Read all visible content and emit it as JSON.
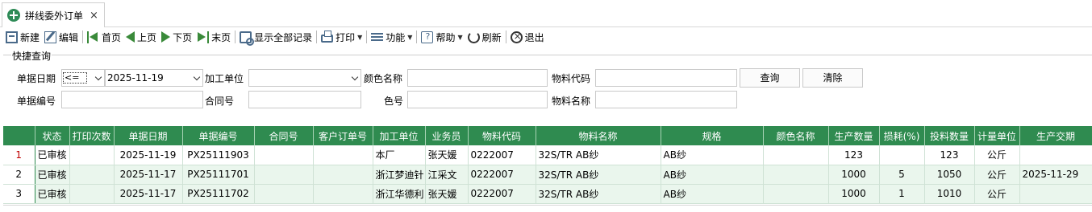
{
  "tab": {
    "title": "拼线委外订单",
    "close": "×"
  },
  "toolbar": {
    "new": "新建",
    "edit": "编辑",
    "first": "首页",
    "prev": "上页",
    "next": "下页",
    "last": "末页",
    "show_all": "显示全部记录",
    "print": "打印",
    "function": "功能",
    "help": "帮助",
    "refresh": "刷新",
    "exit": "退出"
  },
  "query": {
    "legend": "快捷查询",
    "doc_date_label": "单据日期",
    "doc_date_op": "<=",
    "doc_date_value": "2025-11-19",
    "processor_label": "加工单位",
    "processor_value": "",
    "color_name_label": "颜色名称",
    "color_name_value": "",
    "material_code_label": "物料代码",
    "material_code_value": "",
    "search_button": "查询",
    "clear_button": "清除",
    "doc_no_label": "单据编号",
    "doc_no_value": "",
    "contract_label": "合同号",
    "contract_value": "",
    "color_no_label": "色号",
    "color_no_value": "",
    "material_name_label": "物料名称",
    "material_name_value": ""
  },
  "grid": {
    "headers": [
      "",
      "状态",
      "打印次数",
      "单据日期",
      "单据编号",
      "合同号",
      "客户订单号",
      "加工单位",
      "业务员",
      "物料代码",
      "物料名称",
      "规格",
      "颜色名称",
      "生产数量",
      "损耗(%)",
      "投料数量",
      "计量单位",
      "生产交期"
    ],
    "rows": [
      [
        "1",
        "已审核",
        "",
        "2025-11-19",
        "PX25111903",
        "",
        "",
        "本厂",
        "张天媛",
        "0222007",
        "32S/TR AB纱",
        "AB纱",
        "",
        "123",
        "",
        "123",
        "公斤",
        ""
      ],
      [
        "2",
        "已审核",
        "",
        "2025-11-17",
        "PX25111701",
        "",
        "",
        "浙江梦迪针",
        "江采文",
        "0222007",
        "32S/TR AB纱",
        "AB纱",
        "",
        "1000",
        "5",
        "1050",
        "公斤",
        "2025-11-29"
      ],
      [
        "3",
        "已审核",
        "",
        "2025-11-17",
        "PX25111702",
        "",
        "",
        "浙江华德利",
        "张天媛",
        "0222007",
        "32S/TR AB纱",
        "AB纱",
        "",
        "1000",
        "1",
        "1010",
        "公斤",
        ""
      ]
    ]
  },
  "colors": {
    "header_green": "#2f8b50",
    "row_alt": "#eaf6ed"
  }
}
